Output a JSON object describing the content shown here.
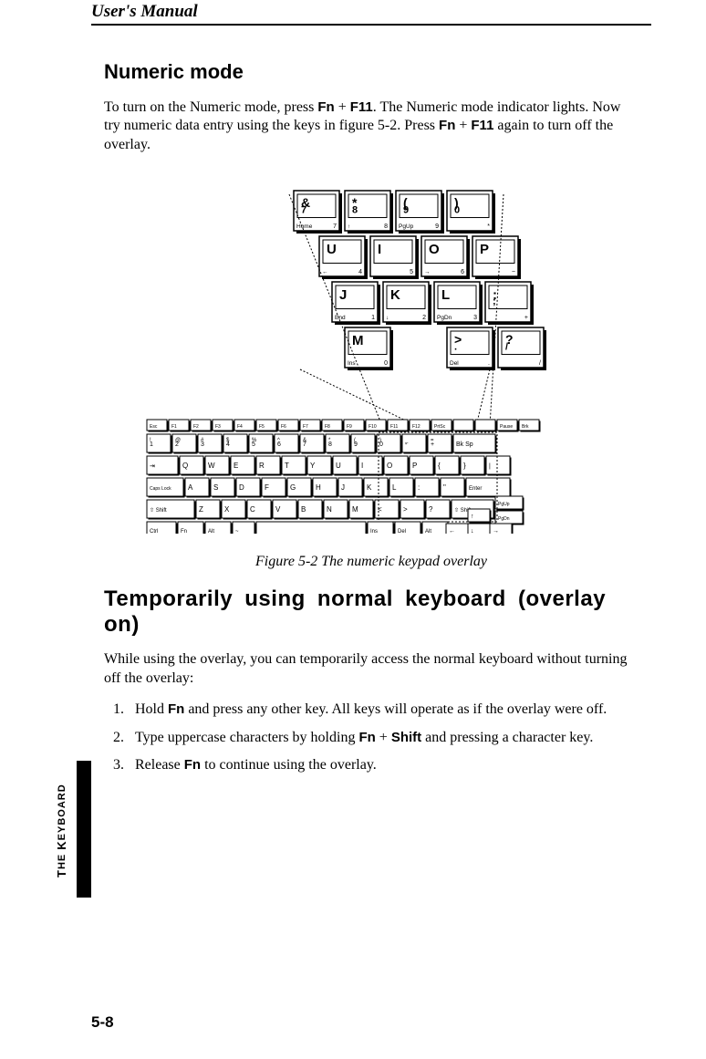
{
  "header": "User's Manual",
  "sections": {
    "numeric": {
      "title": "Numeric mode",
      "p1_a": "To turn on the Numeric mode, press ",
      "p1_b": "Fn",
      "p1_plus": " + ",
      "p1_c": "F11",
      "p1_d": ".  The Numeric mode indicator lights. Now try numeric data entry using the keys in figure 5-2. Press ",
      "p1_e": "Fn",
      "p1_f": "F11",
      "p1_g": " again to turn off the overlay."
    },
    "caption": "Figure 5-2 The numeric keypad overlay",
    "temp": {
      "title": "Temporarily using normal keyboard (overlay on)",
      "intro": "While using the overlay, you can temporarily access the normal keyboard without turning off the overlay:",
      "li1_a": "Hold ",
      "li1_b": "Fn",
      "li1_c": " and press any other key. All keys will operate as if the overlay were off.",
      "li2_a": "Type uppercase characters by holding ",
      "li2_b": "Fn",
      "li2_c": "Shift",
      "li2_d": " and pressing a character key.",
      "li3_a": "Release ",
      "li3_b": "Fn",
      "li3_c": " to continue using the overlay."
    }
  },
  "sideTab": {
    "the": "T",
    "heRest": "HE ",
    "kbd": "K",
    "bdRest": "EYBOARD"
  },
  "pageNum": "5-8",
  "overlayKeys": {
    "row1": [
      {
        "top": "&",
        "mid": "7",
        "bl": "Home",
        "br": "7"
      },
      {
        "top": "*",
        "mid": "8",
        "bl": "↑",
        "br": "8"
      },
      {
        "top": "(",
        "mid": "9",
        "bl": "PgUp",
        "br": "9"
      },
      {
        "top": ")",
        "mid": "0",
        "bl": "",
        "br": "*"
      }
    ],
    "row2": [
      {
        "top": "U",
        "bl": "←",
        "br": "4"
      },
      {
        "top": "I",
        "bl": "",
        "br": "5"
      },
      {
        "top": "O",
        "bl": "→",
        "br": "6"
      },
      {
        "top": "P",
        "bl": "",
        "br": "−"
      }
    ],
    "row3": [
      {
        "top": "J",
        "bl": "End",
        "br": "1"
      },
      {
        "top": "K",
        "bl": "↓",
        "br": "2"
      },
      {
        "top": "L",
        "bl": "PgDn",
        "br": "3"
      },
      {
        "top": ":",
        "mid": ";",
        "bl": "",
        "br": "+"
      }
    ],
    "row4": [
      {
        "top": "M",
        "bl": "Ins",
        "br": "0"
      },
      {
        "top": ">",
        "mid": ".",
        "bl": "Del",
        "br": "."
      },
      {
        "top": "?",
        "mid": "/",
        "bl": "",
        "br": "/"
      }
    ]
  },
  "fullKbd": {
    "fnRow": [
      "Esc",
      "F1",
      "F2",
      "F3",
      "F4",
      "F5",
      "F6",
      "F7",
      "F8",
      "F9",
      "F10",
      "F11",
      "F12",
      "PrtSc",
      "",
      "",
      "Pause",
      "Brk"
    ],
    "numRow": [
      "1",
      "2",
      "3",
      "4",
      "5",
      "6",
      "7",
      "8",
      "9",
      "0",
      "-",
      "+",
      "Bk Sp"
    ],
    "numRowTop": [
      "!",
      "@",
      "#",
      "$",
      "%",
      "^",
      "&",
      "*",
      "(",
      ")",
      "_",
      "=",
      ""
    ],
    "qRow": [
      "Q",
      "W",
      "E",
      "R",
      "T",
      "Y",
      "U",
      "I",
      "O",
      "P",
      "{",
      "}"
    ],
    "aRow": [
      "A",
      "S",
      "D",
      "F",
      "G",
      "H",
      "J",
      "K",
      "L",
      ":",
      "\""
    ],
    "zRow": [
      "Z",
      "X",
      "C",
      "V",
      "B",
      "N",
      "M",
      "<",
      ">",
      "?"
    ],
    "bottom": [
      "Ctrl",
      "Fn",
      "Alt",
      "~",
      "",
      "Ins",
      "Del",
      "Alt"
    ],
    "side": [
      "PgUp",
      "PgDn"
    ],
    "arrows": [
      "↑",
      "←",
      "↓",
      "→"
    ],
    "caps": "Caps Lock",
    "shift": "Shift",
    "enter": "Enter",
    "tab": "⇥"
  }
}
